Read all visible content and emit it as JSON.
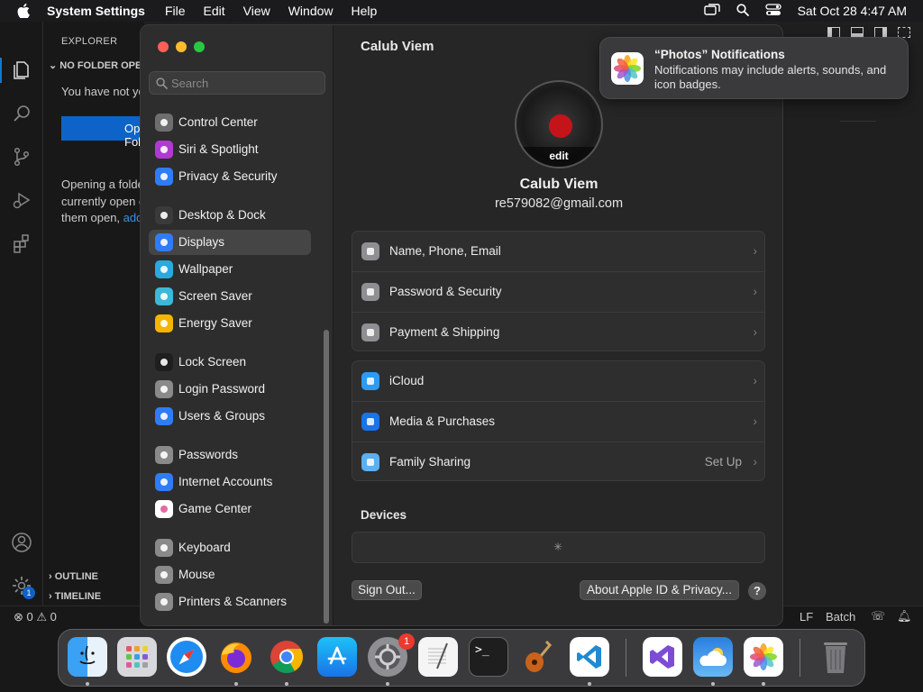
{
  "menubar": {
    "app_name": "System Settings",
    "menus": [
      "File",
      "Edit",
      "View",
      "Window",
      "Help"
    ],
    "datetime": "Sat Oct 28  4:47 AM"
  },
  "vscode": {
    "explorer_title": "EXPLORER",
    "no_folder": "NO FOLDER OPENED",
    "msg1": "You have not yet opened a folder.",
    "open_button": "Open Folder",
    "msg2_line1": "Opening a folder will close all",
    "msg2_line2": "currently open editors. To keep",
    "msg2_line3": "them open, ",
    "msg2_link": "add a folder instead",
    "outline": "OUTLINE",
    "timeline": "TIMELINE",
    "status_errors": "0",
    "status_warnings": "0",
    "status_lf": "LF",
    "status_lang": "Batch",
    "settings_badge": "1"
  },
  "settings": {
    "search_placeholder": "Search",
    "sidebar_items": [
      {
        "label": "Control Center",
        "icon": "control-center-icon",
        "color": "#6e6e6e"
      },
      {
        "label": "Siri & Spotlight",
        "icon": "siri-icon",
        "color": "#b03ad0"
      },
      {
        "label": "Privacy & Security",
        "icon": "hand-icon",
        "color": "#2f7cf6"
      },
      {
        "label": "Desktop & Dock",
        "icon": "dock-icon",
        "color": "#3a3a3a"
      },
      {
        "label": "Displays",
        "icon": "sun-icon",
        "color": "#2f7cf6"
      },
      {
        "label": "Wallpaper",
        "icon": "flower-icon",
        "color": "#2aa8e0"
      },
      {
        "label": "Screen Saver",
        "icon": "screensaver-icon",
        "color": "#3cb8d8"
      },
      {
        "label": "Energy Saver",
        "icon": "bulb-icon",
        "color": "#f5b400"
      },
      {
        "label": "Lock Screen",
        "icon": "lock-icon",
        "color": "#1f1f1f"
      },
      {
        "label": "Login Password",
        "icon": "lock-icon",
        "color": "#8a8a8a"
      },
      {
        "label": "Users & Groups",
        "icon": "users-icon",
        "color": "#2f7cf6"
      },
      {
        "label": "Passwords",
        "icon": "key-icon",
        "color": "#8a8a8a"
      },
      {
        "label": "Internet Accounts",
        "icon": "at-icon",
        "color": "#2f7cf6"
      },
      {
        "label": "Game Center",
        "icon": "gamecenter-icon",
        "color": "#ffffff"
      },
      {
        "label": "Keyboard",
        "icon": "keyboard-icon",
        "color": "#8a8a8a"
      },
      {
        "label": "Mouse",
        "icon": "mouse-icon",
        "color": "#8a8a8a"
      },
      {
        "label": "Printers & Scanners",
        "icon": "printer-icon",
        "color": "#8a8a8a"
      }
    ],
    "selected_item": "Displays",
    "page_title": "Calub Viem",
    "avatar_edit": "edit",
    "user_name": "Calub Viem",
    "user_email": "re579082@gmail.com",
    "group1": [
      {
        "label": "Name, Phone, Email",
        "icon": "contact-icon"
      },
      {
        "label": "Password & Security",
        "icon": "lock-icon"
      },
      {
        "label": "Payment & Shipping",
        "icon": "card-icon"
      }
    ],
    "group2": [
      {
        "label": "iCloud",
        "icon": "cloud-icon",
        "extra": ""
      },
      {
        "label": "Media & Purchases",
        "icon": "appstore-icon",
        "extra": ""
      },
      {
        "label": "Family Sharing",
        "icon": "family-icon",
        "extra": "Set Up"
      }
    ],
    "devices_header": "Devices",
    "sign_out": "Sign Out...",
    "about": "About Apple ID & Privacy...",
    "help": "?"
  },
  "notification": {
    "title": "“Photos” Notifications",
    "body": "Notifications may include alerts, sounds, and icon badges."
  },
  "dock": {
    "items": [
      "Finder",
      "Launchpad",
      "Safari",
      "Firefox",
      "Chrome",
      "App Store",
      "System Settings",
      "TextEdit",
      "Terminal",
      "GarageBand",
      "Visual Studio Code",
      "Visual Studio",
      "Weather",
      "Photos",
      "Trash"
    ],
    "settings_badge": "1"
  }
}
